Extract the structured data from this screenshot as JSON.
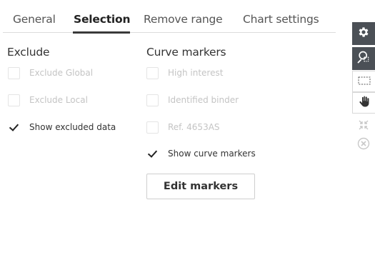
{
  "tabs": [
    {
      "label": "General",
      "active": false
    },
    {
      "label": "Selection",
      "active": true
    },
    {
      "label": "Remove range",
      "active": false
    },
    {
      "label": "Chart settings",
      "active": false
    }
  ],
  "exclude": {
    "title": "Exclude",
    "options": [
      {
        "label": "Exclude Global",
        "checked": false,
        "enabled": false
      },
      {
        "label": "Exclude Local",
        "checked": false,
        "enabled": false
      },
      {
        "label": "Show excluded data",
        "checked": true,
        "enabled": true
      }
    ]
  },
  "curve_markers": {
    "title": "Curve markers",
    "options": [
      {
        "label": "High interest",
        "checked": false,
        "enabled": false
      },
      {
        "label": "Identified binder",
        "checked": false,
        "enabled": false
      },
      {
        "label": "Ref. 4653AS",
        "checked": false,
        "enabled": false
      },
      {
        "label": "Show curve markers",
        "checked": true,
        "enabled": true
      }
    ],
    "edit_button": "Edit markers"
  },
  "toolbar": {
    "items": [
      {
        "name": "settings-gear-icon",
        "active": true
      },
      {
        "name": "zoom-select-icon",
        "active": true
      },
      {
        "name": "marquee-select-icon",
        "active": false
      },
      {
        "name": "pan-hand-icon",
        "active": false
      },
      {
        "name": "collapse-arrows-icon",
        "active": false
      },
      {
        "name": "close-circle-icon",
        "active": false
      }
    ]
  },
  "colors": {
    "toolbar_active": "#4b5056",
    "disabled_text": "#c4c4c4",
    "text": "#333333"
  }
}
